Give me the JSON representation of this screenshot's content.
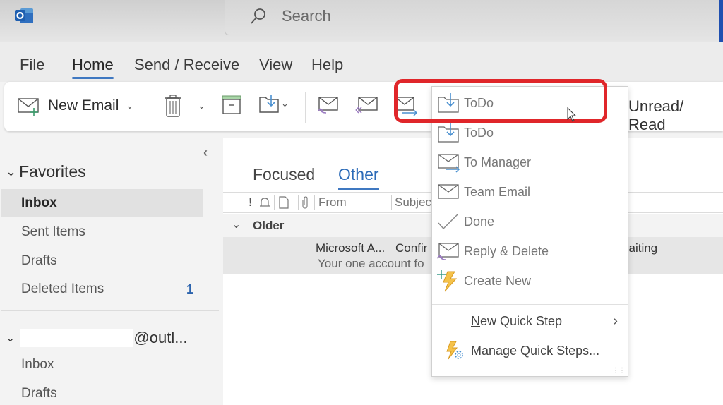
{
  "titlebar": {
    "search_placeholder": "Search"
  },
  "menubar": {
    "tabs": [
      {
        "label": "File"
      },
      {
        "label": "Home",
        "active": true
      },
      {
        "label": "Send / Receive"
      },
      {
        "label": "View"
      },
      {
        "label": "Help"
      }
    ]
  },
  "ribbon": {
    "new_email_label": "New Email",
    "unread_read_label": "Unread/ Read"
  },
  "sidebar": {
    "favorites_label": "Favorites",
    "favorites": [
      {
        "label": "Inbox",
        "selected": true
      },
      {
        "label": "Sent Items"
      },
      {
        "label": "Drafts"
      },
      {
        "label": "Deleted Items",
        "count": "1"
      }
    ],
    "account_suffix": "@outl...",
    "account_folders": [
      {
        "label": "Inbox"
      },
      {
        "label": "Drafts"
      }
    ]
  },
  "mail": {
    "tabs": [
      {
        "label": "Focused"
      },
      {
        "label": "Other",
        "active": true
      }
    ],
    "columns": {
      "importance": "!",
      "from": "From",
      "subject": "Subjec"
    },
    "group_label": "Older",
    "messages": [
      {
        "from": "Microsoft A...",
        "subject": "Confir",
        "preview": "Your one account fo",
        "status": "vaiting"
      }
    ]
  },
  "quick_steps_menu": {
    "items": [
      {
        "label": "ToDo",
        "icon": "folder-move-icon"
      },
      {
        "label": "ToDo",
        "icon": "folder-move-icon"
      },
      {
        "label": "To Manager",
        "icon": "mail-forward-icon"
      },
      {
        "label": "Team Email",
        "icon": "mail-icon"
      },
      {
        "label": "Done",
        "icon": "checkmark-icon"
      },
      {
        "label": "Reply & Delete",
        "icon": "mail-reply-icon"
      },
      {
        "label": "Create New",
        "icon": "lightning-plus-icon"
      }
    ],
    "new_quick_step": {
      "accel": "N",
      "rest": "ew Quick Step"
    },
    "manage_quick_steps": {
      "accel": "M",
      "rest": "anage Quick Steps..."
    }
  },
  "colors": {
    "accent": "#3f78c1",
    "highlight_box": "#e0262a",
    "count_badge": "#2b63ad"
  }
}
